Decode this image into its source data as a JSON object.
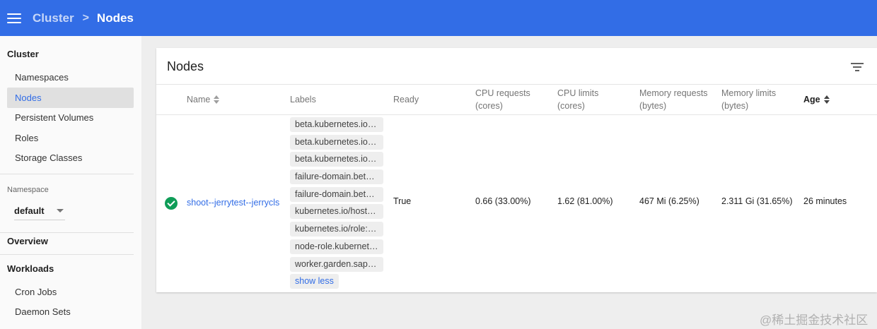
{
  "header": {
    "breadcrumb_parent": "Cluster",
    "breadcrumb_separator": ">",
    "breadcrumb_current": "Nodes"
  },
  "sidebar": {
    "cluster_heading": "Cluster",
    "cluster_items": [
      {
        "label": "Namespaces",
        "active": false
      },
      {
        "label": "Nodes",
        "active": true
      },
      {
        "label": "Persistent Volumes",
        "active": false
      },
      {
        "label": "Roles",
        "active": false
      },
      {
        "label": "Storage Classes",
        "active": false
      }
    ],
    "namespace_label": "Namespace",
    "namespace_value": "default",
    "overview_heading": "Overview",
    "workloads_heading": "Workloads",
    "workloads_items": [
      {
        "label": "Cron Jobs"
      },
      {
        "label": "Daemon Sets"
      }
    ]
  },
  "card": {
    "title": "Nodes",
    "columns": {
      "name": "Name",
      "labels": "Labels",
      "ready": "Ready",
      "cpu_requests": [
        "CPU requests",
        "(cores)"
      ],
      "cpu_limits": [
        "CPU limits",
        "(cores)"
      ],
      "memory_requests": [
        "Memory requests",
        "(bytes)"
      ],
      "memory_limits": [
        "Memory limits",
        "(bytes)"
      ],
      "age": "Age"
    },
    "rows": [
      {
        "status": "ready",
        "name": "shoot--jerrytest--jerrycls",
        "labels": [
          "beta.kubernetes.io/ar...",
          "beta.kubernetes.io/in...",
          "beta.kubernetes.io/o...",
          "failure-domain.beta.k...",
          "failure-domain.beta.k...",
          "kubernetes.io/hostna...",
          "kubernetes.io/role: n...",
          "node-role.kubernetes...",
          "worker.garden.sapclo..."
        ],
        "show_less": "show less",
        "ready": "True",
        "cpu_requests": "0.66 (33.00%)",
        "cpu_limits": "1.62 (81.00%)",
        "memory_requests": "467 Mi (6.25%)",
        "memory_limits": "2.311 Gi (31.65%)",
        "age": "26 minutes"
      }
    ]
  },
  "watermark": "@稀土掘金技术社区",
  "colors": {
    "accent": "#326de6",
    "ready_status": "#0f9d58"
  }
}
